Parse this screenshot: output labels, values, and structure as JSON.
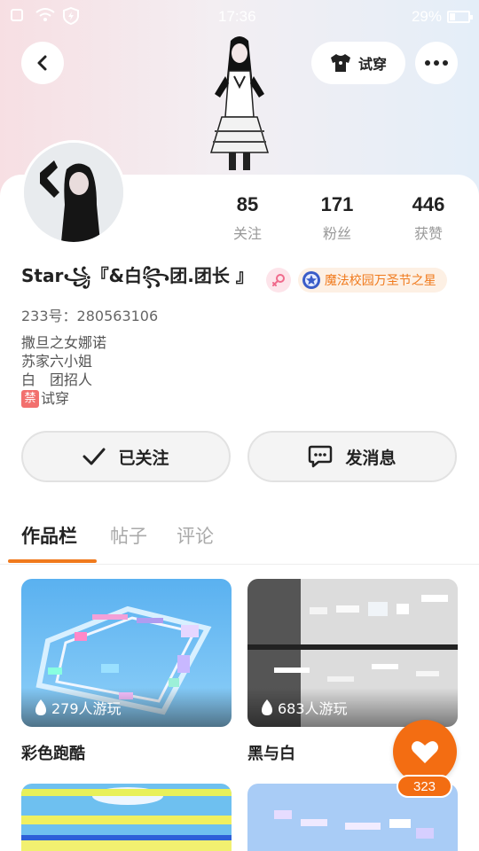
{
  "status_bar": {
    "time": "17:36",
    "battery": "29%",
    "battery_level": 0.29
  },
  "header": {
    "try_on_label": "试穿"
  },
  "profile": {
    "name": "Star꧁『&白꧂团.团长 』",
    "title_badge": "魔法校园万圣节之星",
    "uid": "233号：280563106",
    "bio_lines": [
      "撒旦之女娜诺",
      "苏家六小姐",
      "白　团招人"
    ],
    "bio_ban_tag": "禁",
    "bio_last_line": "试穿"
  },
  "stats": [
    {
      "value": "85",
      "label": "关注"
    },
    {
      "value": "171",
      "label": "粉丝"
    },
    {
      "value": "446",
      "label": "获赞"
    }
  ],
  "actions": {
    "follow_label": "已关注",
    "message_label": "发消息"
  },
  "tabs": [
    {
      "label": "作品栏",
      "active": true
    },
    {
      "label": "帖子",
      "active": false
    },
    {
      "label": "评论",
      "active": false
    }
  ],
  "works": [
    {
      "title": "彩色跑酷",
      "plays": "279人游玩"
    },
    {
      "title": "黑与白",
      "plays": "683人游玩"
    }
  ],
  "like_fab": {
    "count": "323",
    "color": "#f36d12"
  },
  "colors": {
    "accent": "#f07a1d"
  }
}
